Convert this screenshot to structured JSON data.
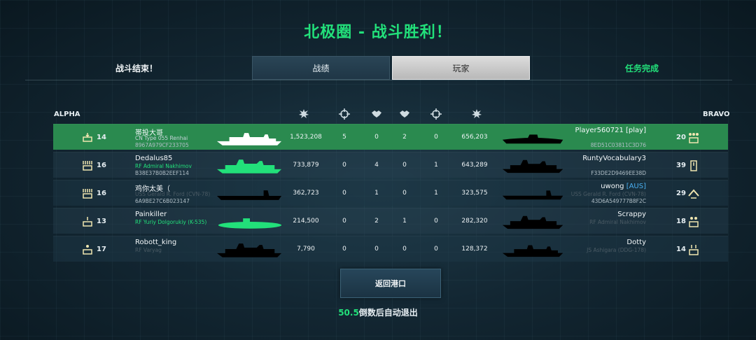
{
  "title": "北极圈 - 战斗胜利！",
  "battle_end_label": "战斗结束！",
  "tabs": [
    {
      "label": "战绩",
      "active": false
    },
    {
      "label": "玩家",
      "active": true
    }
  ],
  "mission_label": "任务完成",
  "teams": {
    "left": "ALPHA",
    "right": "BRAVO"
  },
  "header_icons": [
    "explosion-icon",
    "crosshair-icon",
    "handshake-icon",
    "handshake-icon",
    "crosshair-icon",
    "explosion-icon"
  ],
  "rows": [
    {
      "left": {
        "level": "14",
        "name": "帯投大哥",
        "ship": "CN Type 055 Renhai",
        "ship_style": "normal",
        "id": "8967A979CF233705",
        "ship_icon_color": "#ffffff"
      },
      "stats": [
        "1,523,208",
        "5",
        "0",
        "2",
        "0",
        "656,203"
      ],
      "right": {
        "name": "Player560721 [play]",
        "tag": "",
        "ship": "",
        "id": "8ED51C03811C3D76",
        "level": "20"
      }
    },
    {
      "left": {
        "level": "16",
        "name": "Dedalus85",
        "ship": "RF Admiral Nakhimov",
        "ship_style": "green",
        "id": "B38E37B0B2EEF114",
        "ship_icon_color": "#22e07a"
      },
      "stats": [
        "733,879",
        "0",
        "4",
        "0",
        "1",
        "643,289"
      ],
      "right": {
        "name": "RuntyVocabulary3",
        "tag": "",
        "ship": "",
        "id": "F33DE2D9469EE38D",
        "level": "39"
      }
    },
    {
      "left": {
        "level": "16",
        "name": "鸡你太美（",
        "ship": "USS Gerald R. Ford (CVN-78)",
        "ship_style": "dim",
        "id": "6A9BE27C6B023147",
        "ship_icon_color": "#000000"
      },
      "stats": [
        "362,723",
        "0",
        "1",
        "0",
        "1",
        "323,575"
      ],
      "right": {
        "name": "uwong ",
        "tag": "[AUS]",
        "ship": "USS Gerald R. Ford (CVN-78)",
        "id": "43D6A549777B8F2C",
        "level": "29"
      }
    },
    {
      "left": {
        "level": "13",
        "name": "Painkiller",
        "ship": "RF Yuriy Dolgorukiy (K-535)",
        "ship_style": "green",
        "id": "",
        "ship_icon_color": "#22e07a"
      },
      "stats": [
        "214,500",
        "0",
        "2",
        "1",
        "0",
        "282,320"
      ],
      "right": {
        "name": "Scrappy",
        "tag": "",
        "ship": "RF Admiral Nakhimov",
        "id": "",
        "level": "18"
      }
    },
    {
      "left": {
        "level": "17",
        "name": "Robott_king",
        "ship": "RF Varyag",
        "ship_style": "dim",
        "id": "",
        "ship_icon_color": "#000000"
      },
      "stats": [
        "7,790",
        "0",
        "0",
        "0",
        "0",
        "128,372"
      ],
      "right": {
        "name": "Dotty",
        "tag": "",
        "ship": "JS Ashigara (DDG-178)",
        "id": "",
        "level": "14"
      }
    }
  ],
  "return_button": "返回港口",
  "countdown": {
    "seconds": "50.5",
    "text": "倒数后自动退出"
  },
  "colors": {
    "accent_green": "#22e07a",
    "highlight_row": "#2a8a4f",
    "tag_blue": "#4aaef0"
  }
}
